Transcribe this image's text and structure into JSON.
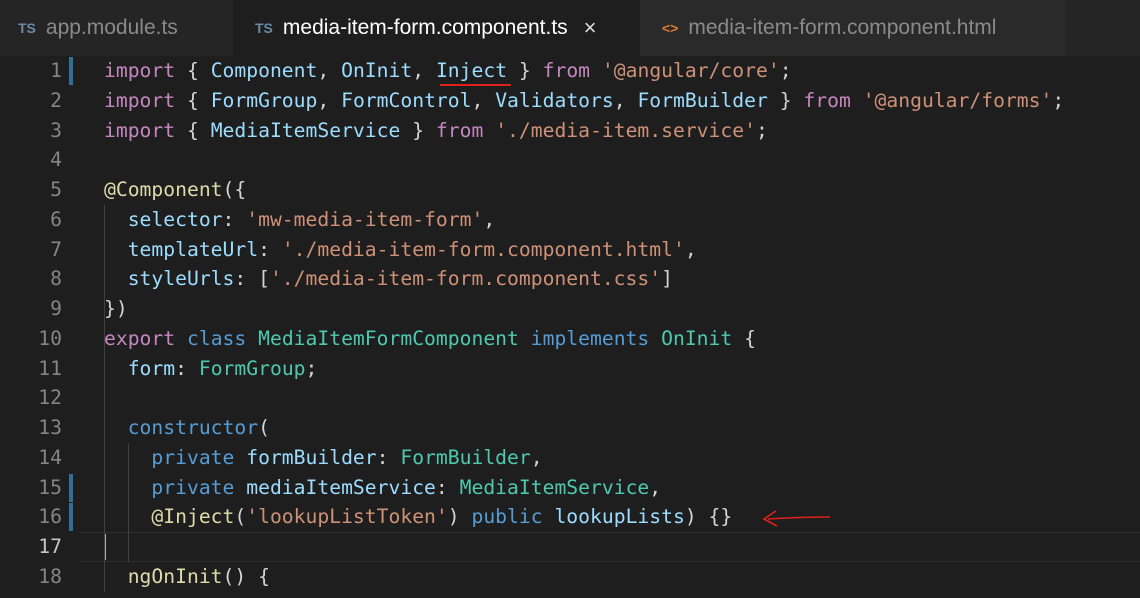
{
  "tabs": [
    {
      "icon": "TS",
      "label": "app.module.ts",
      "active": false
    },
    {
      "icon": "TS",
      "label": "media-item-form.component.ts",
      "active": true,
      "close": "×"
    },
    {
      "icon": "<>",
      "label": "media-item-form.component.html",
      "active": false
    }
  ],
  "colors": {
    "keyword": "#c586c0",
    "identifier": "#9cdcfe",
    "type": "#4ec9b0",
    "string": "#ce9178",
    "storage": "#569cd6",
    "function": "#dcdcaa",
    "annotation": "#e0201c"
  },
  "editor": {
    "current_line": 17,
    "lines": [
      {
        "n": "1",
        "t": [
          [
            "import",
            "kw"
          ],
          [
            " { ",
            "pl"
          ],
          [
            "Component",
            "id"
          ],
          [
            ", ",
            "pl"
          ],
          [
            "OnInit",
            "id"
          ],
          [
            ", ",
            "pl"
          ],
          [
            "Inject",
            "id"
          ],
          [
            " } ",
            "pl"
          ],
          [
            "from",
            "kw"
          ],
          [
            " ",
            "pl"
          ],
          [
            "'@angular/core'",
            "st"
          ],
          [
            ";",
            "pl"
          ]
        ]
      },
      {
        "n": "2",
        "t": [
          [
            "import",
            "kw"
          ],
          [
            " { ",
            "pl"
          ],
          [
            "FormGroup",
            "id"
          ],
          [
            ", ",
            "pl"
          ],
          [
            "FormControl",
            "id"
          ],
          [
            ", ",
            "pl"
          ],
          [
            "Validators",
            "id"
          ],
          [
            ", ",
            "pl"
          ],
          [
            "FormBuilder",
            "id"
          ],
          [
            " } ",
            "pl"
          ],
          [
            "from",
            "kw"
          ],
          [
            " ",
            "pl"
          ],
          [
            "'@angular/forms'",
            "st"
          ],
          [
            ";",
            "pl"
          ]
        ]
      },
      {
        "n": "3",
        "t": [
          [
            "import",
            "kw"
          ],
          [
            " { ",
            "pl"
          ],
          [
            "MediaItemService",
            "id"
          ],
          [
            " } ",
            "pl"
          ],
          [
            "from",
            "kw"
          ],
          [
            " ",
            "pl"
          ],
          [
            "'./media-item.service'",
            "st"
          ],
          [
            ";",
            "pl"
          ]
        ]
      },
      {
        "n": "4",
        "t": []
      },
      {
        "n": "5",
        "t": [
          [
            "@Component",
            "fn"
          ],
          [
            "({",
            "pl"
          ]
        ]
      },
      {
        "n": "6",
        "t": [
          [
            "  selector",
            "id"
          ],
          [
            ": ",
            "pl"
          ],
          [
            "'mw-media-item-form'",
            "st"
          ],
          [
            ",",
            "pl"
          ]
        ]
      },
      {
        "n": "7",
        "t": [
          [
            "  templateUrl",
            "id"
          ],
          [
            ": ",
            "pl"
          ],
          [
            "'./media-item-form.component.html'",
            "st"
          ],
          [
            ",",
            "pl"
          ]
        ]
      },
      {
        "n": "8",
        "t": [
          [
            "  styleUrls",
            "id"
          ],
          [
            ": [",
            "pl"
          ],
          [
            "'./media-item-form.component.css'",
            "st"
          ],
          [
            "]",
            "pl"
          ]
        ]
      },
      {
        "n": "9",
        "t": [
          [
            "})",
            "pl"
          ]
        ]
      },
      {
        "n": "10",
        "t": [
          [
            "export",
            "kw"
          ],
          [
            " ",
            "pl"
          ],
          [
            "class",
            "bl"
          ],
          [
            " ",
            "pl"
          ],
          [
            "MediaItemFormComponent",
            "ty"
          ],
          [
            " ",
            "pl"
          ],
          [
            "implements",
            "bl"
          ],
          [
            " ",
            "pl"
          ],
          [
            "OnInit",
            "ty"
          ],
          [
            " {",
            "pl"
          ]
        ]
      },
      {
        "n": "11",
        "t": [
          [
            "  form",
            "id"
          ],
          [
            ": ",
            "pl"
          ],
          [
            "FormGroup",
            "ty"
          ],
          [
            ";",
            "pl"
          ]
        ]
      },
      {
        "n": "12",
        "t": []
      },
      {
        "n": "13",
        "t": [
          [
            "  constructor",
            "bl"
          ],
          [
            "(",
            "pl"
          ]
        ]
      },
      {
        "n": "14",
        "t": [
          [
            "    private",
            "bl"
          ],
          [
            " ",
            "pl"
          ],
          [
            "formBuilder",
            "id"
          ],
          [
            ": ",
            "pl"
          ],
          [
            "FormBuilder",
            "ty"
          ],
          [
            ",",
            "pl"
          ]
        ]
      },
      {
        "n": "15",
        "t": [
          [
            "    private",
            "bl"
          ],
          [
            " ",
            "pl"
          ],
          [
            "mediaItemService",
            "id"
          ],
          [
            ": ",
            "pl"
          ],
          [
            "MediaItemService",
            "ty"
          ],
          [
            ",",
            "pl"
          ]
        ]
      },
      {
        "n": "16",
        "t": [
          [
            "    @Inject",
            "fn"
          ],
          [
            "(",
            "pl"
          ],
          [
            "'lookupListToken'",
            "st"
          ],
          [
            ") ",
            "pl"
          ],
          [
            "public",
            "bl"
          ],
          [
            " ",
            "pl"
          ],
          [
            "lookupLists",
            "id"
          ],
          [
            ") {}",
            "pl"
          ]
        ]
      },
      {
        "n": "17",
        "t": []
      },
      {
        "n": "18",
        "t": [
          [
            "  ngOnInit",
            "fn"
          ],
          [
            "() {",
            "pl"
          ]
        ]
      }
    ]
  }
}
